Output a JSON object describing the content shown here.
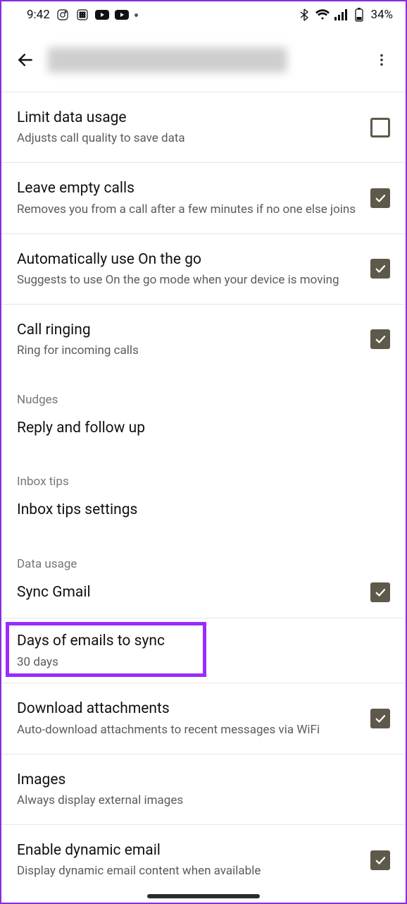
{
  "statusbar": {
    "time": "9:42",
    "battery": "34%"
  },
  "settings": {
    "items": [
      {
        "title": "Limit data usage",
        "sub": "Adjusts call quality to save data"
      },
      {
        "title": "Leave empty calls",
        "sub": "Removes you from a call after a few minutes if no one else joins"
      },
      {
        "title": "Automatically use On the go",
        "sub": "Suggests to use On the go mode when your device is moving"
      },
      {
        "title": "Call ringing",
        "sub": "Ring for incoming calls"
      }
    ],
    "section_nudges": "Nudges",
    "reply_follow": "Reply and follow up",
    "section_inbox": "Inbox tips",
    "inbox_tips": "Inbox tips settings",
    "section_data": "Data usage",
    "sync_gmail": "Sync Gmail",
    "days_sync_title": "Days of emails to sync",
    "days_sync_sub": "30 days",
    "download_att_title": "Download attachments",
    "download_att_sub": "Auto-download attachments to recent messages via WiFi",
    "images_title": "Images",
    "images_sub": "Always display external images",
    "dynamic_title": "Enable dynamic email",
    "dynamic_sub": "Display dynamic email content when available"
  }
}
